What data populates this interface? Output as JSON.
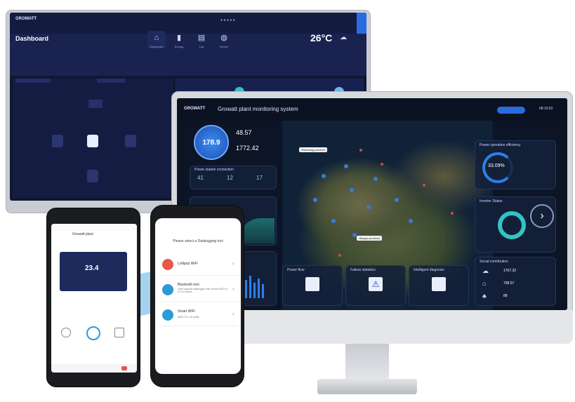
{
  "dashboard": {
    "logo": "GROWATT",
    "title": "Dashboard",
    "tabs": [
      "Dashboard",
      "Energy",
      "Log",
      "Device"
    ],
    "temperature": "26°C"
  },
  "monitoring": {
    "logo": "GROWATT",
    "title": "Growatt plant monitoring system",
    "time": "08:19:52",
    "total_power": "178.9",
    "stat1": "48.57",
    "stat2": "1772.42",
    "panels": {
      "connection": "Power station connection",
      "counts": [
        "41",
        "12",
        "17"
      ],
      "efficiency": "Power operation efficiency",
      "efficiency_value": "33.09%",
      "inverter": "Inverter Status",
      "social": "Social contribution",
      "social_values": [
        "1767.32",
        "708.57",
        "88"
      ],
      "power_flow": "Power flow",
      "failure": "Failure statistics",
      "diagnosis": "Intelligent diagnosis"
    },
    "map_callouts": [
      "Shandong province",
      "Jiangsu province"
    ]
  },
  "phone_left": {
    "value": "23.4",
    "title": "Growatt plant"
  },
  "phone_right": {
    "title": "Please select a Datalogging tool",
    "options": [
      {
        "title": "Lollipop WiFi",
        "icon": "wifi-icon",
        "color": "#e8584a"
      },
      {
        "title": "Bluetooth tool",
        "sub": "Only supports datalogger with version WiFi-S / S-X or above",
        "icon": "bluetooth-icon",
        "color": "#2b9bd6"
      },
      {
        "title": "Smart WiFi",
        "sub": "WiFi-T/L-X4 (old)",
        "icon": "wifi-icon",
        "color": "#2b9bd6"
      }
    ]
  },
  "colors": {
    "accent": "#2b6be0",
    "teal": "#33c3c7",
    "dark_navy": "#0c1426"
  }
}
